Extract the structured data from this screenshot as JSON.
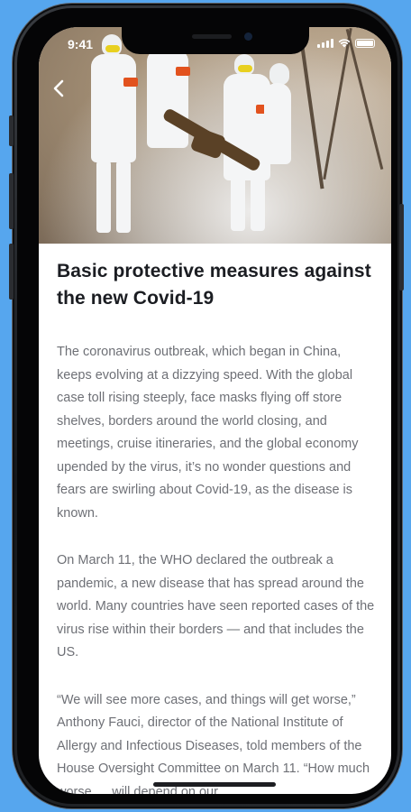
{
  "status_bar": {
    "time": "9:41"
  },
  "nav": {
    "back_icon": "chevron-left-icon"
  },
  "article": {
    "title": "Basic protective measures against the new Covid-19",
    "paragraphs": [
      "The coronavirus outbreak, which began in China, keeps evolving at a dizzying speed. With the global case toll rising steeply, face masks flying off store shelves, borders around the world closing, and meetings, cruise itineraries, and the global economy upended by the virus, it’s no wonder questions and fears are swirling about Covid-19, as the disease is known.",
      "On March 11, the WHO declared the outbreak a pandemic, a new disease that has spread around the world. Many countries have seen reported cases of the virus rise within their borders — and that includes the US.",
      "“We will see more cases, and things will get worse,” Anthony Fauci, director of the National Institute of Allergy and Infectious Diseases, told members of the House Oversight Committee on March 11. “How much worse … will depend on our"
    ]
  },
  "colors": {
    "background": "#56a6ee",
    "title": "#1b1d22",
    "body_text": "#6e7076"
  }
}
